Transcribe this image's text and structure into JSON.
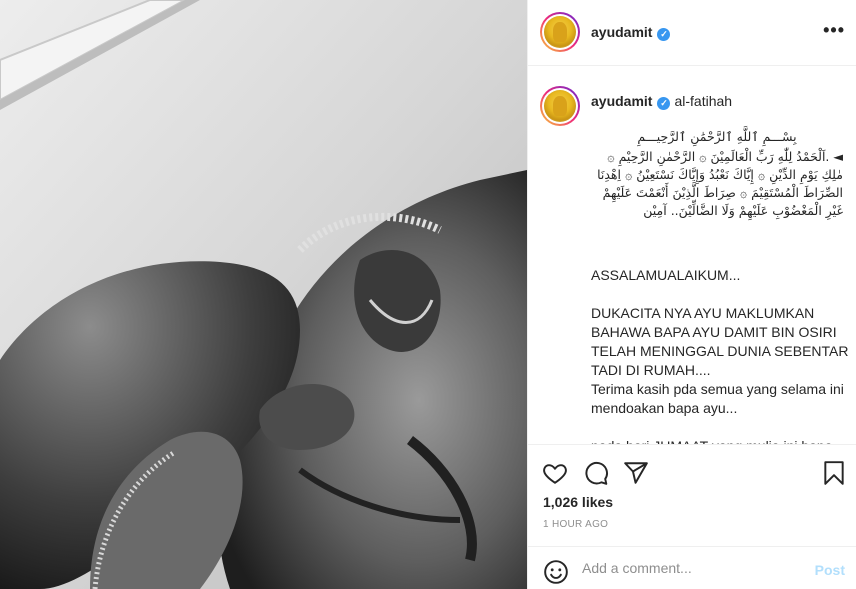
{
  "post": {
    "username": "ayudamit",
    "verified": true,
    "location": "al-fatihah",
    "photo_description": "black-and-white-close-up-face"
  },
  "header": {
    "username": "ayudamit",
    "more_icon": "more-horizontal-icon",
    "more_label": "•••"
  },
  "caption": {
    "username": "ayudamit",
    "location": "al-fatihah",
    "arabic_bismillah": "بِسْـــمِ ٱللَّهِ ٱلرَّحْمَٰنِ ٱلرَّحِيـــمِ",
    "arabic_body": "◄ .اَلْحَمْدُ لِلّٰهِ رَبِّ الْعَالَمِيْنَ ۞ الرَّحْمٰنِ الرَّحِيْمِ ۞ مٰلِكِ يَوْمِ الدِّيْنِ ۞ إِيَّاكَ نَعْبُدُ وَإِيَّاكَ نَسْتَعِيْنُ ۞ اِهْدِنَا الصِّرَاطَ الْمُسْتَقِيْمَ ۞ صِرَاطَ الَّذِيْنَ أَنْعَمْتَ عَلَيْهِمْ غَيْرِ الْمَغْضُوْبِ عَلَيْهِمْ وَلَا الضَّالِّيْنَ.. آمِيْن",
    "body": "ASSALAMUALAIKUM...\n\nDUKACITA NYA AYU MAKLUMKAN BAHAWA BAPA AYU DAMIT BIN OSIRI TELAH MENINGGAL DUNIA SEBENTAR TADI DI RUMAH....\nTerima kasih pda semua yang selama ini mendoakan bapa ayu...\n\npada hari JUMAAT yang mulia ini bapa telah pergi buat selamanya...\nSemoga bapa ditempatkan"
  },
  "actions": {
    "like_icon": "heart-icon",
    "comment_icon": "comment-icon",
    "share_icon": "share-icon",
    "save_icon": "bookmark-icon",
    "likes": "1,026 likes",
    "time": "1 HOUR AGO"
  },
  "comment": {
    "emoji_icon": "smiley-icon",
    "placeholder": "Add a comment...",
    "post_label": "Post"
  }
}
